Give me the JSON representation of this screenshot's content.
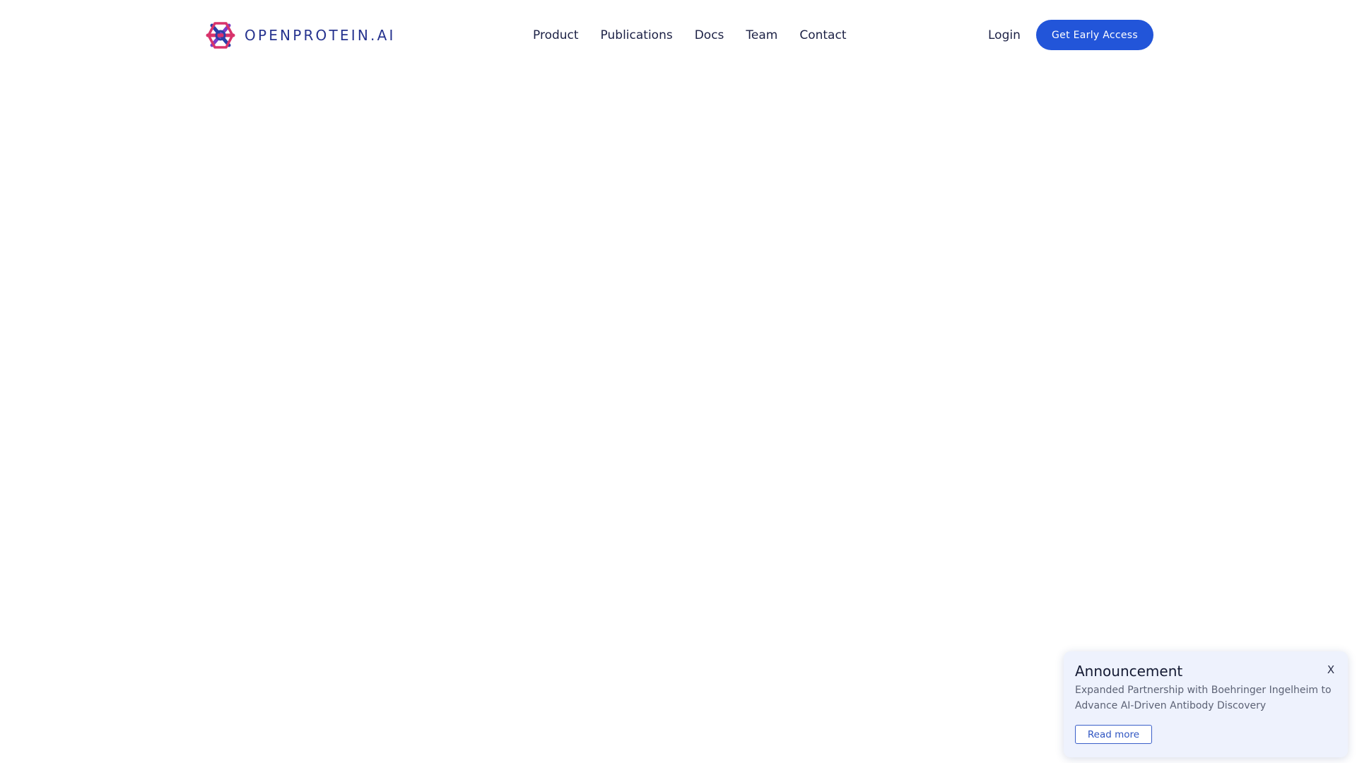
{
  "brand": {
    "name": "OPENPROTEIN.AI",
    "logo_icon": "protein-knot-icon",
    "logo_colors": [
      "#d8336b",
      "#7a3cc7",
      "#2a3fa8"
    ],
    "text_color": "#26338f"
  },
  "nav": {
    "items": [
      {
        "label": "Product"
      },
      {
        "label": "Publications"
      },
      {
        "label": "Docs"
      },
      {
        "label": "Team"
      },
      {
        "label": "Contact"
      }
    ]
  },
  "header_actions": {
    "login_label": "Login",
    "cta_label": "Get Early Access",
    "cta_color": "#2255d9"
  },
  "announcement": {
    "title": "Announcement",
    "close_label": "X",
    "body": "Expanded Partnership with Boehringer Ingelheim to Advance AI-Driven Antibody Discovery",
    "button_label": "Read more",
    "background": "#eef2fd"
  }
}
